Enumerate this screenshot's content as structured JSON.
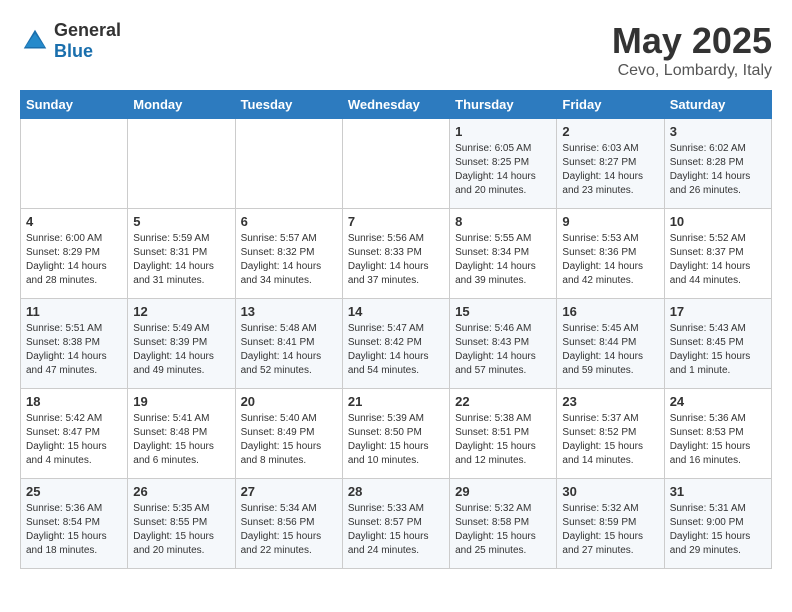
{
  "header": {
    "logo_general": "General",
    "logo_blue": "Blue",
    "month": "May 2025",
    "location": "Cevo, Lombardy, Italy"
  },
  "weekdays": [
    "Sunday",
    "Monday",
    "Tuesday",
    "Wednesday",
    "Thursday",
    "Friday",
    "Saturday"
  ],
  "weeks": [
    [
      {
        "day": "",
        "sunrise": "",
        "sunset": "",
        "daylight": ""
      },
      {
        "day": "",
        "sunrise": "",
        "sunset": "",
        "daylight": ""
      },
      {
        "day": "",
        "sunrise": "",
        "sunset": "",
        "daylight": ""
      },
      {
        "day": "",
        "sunrise": "",
        "sunset": "",
        "daylight": ""
      },
      {
        "day": "1",
        "sunrise": "Sunrise: 6:05 AM",
        "sunset": "Sunset: 8:25 PM",
        "daylight": "Daylight: 14 hours and 20 minutes."
      },
      {
        "day": "2",
        "sunrise": "Sunrise: 6:03 AM",
        "sunset": "Sunset: 8:27 PM",
        "daylight": "Daylight: 14 hours and 23 minutes."
      },
      {
        "day": "3",
        "sunrise": "Sunrise: 6:02 AM",
        "sunset": "Sunset: 8:28 PM",
        "daylight": "Daylight: 14 hours and 26 minutes."
      }
    ],
    [
      {
        "day": "4",
        "sunrise": "Sunrise: 6:00 AM",
        "sunset": "Sunset: 8:29 PM",
        "daylight": "Daylight: 14 hours and 28 minutes."
      },
      {
        "day": "5",
        "sunrise": "Sunrise: 5:59 AM",
        "sunset": "Sunset: 8:31 PM",
        "daylight": "Daylight: 14 hours and 31 minutes."
      },
      {
        "day": "6",
        "sunrise": "Sunrise: 5:57 AM",
        "sunset": "Sunset: 8:32 PM",
        "daylight": "Daylight: 14 hours and 34 minutes."
      },
      {
        "day": "7",
        "sunrise": "Sunrise: 5:56 AM",
        "sunset": "Sunset: 8:33 PM",
        "daylight": "Daylight: 14 hours and 37 minutes."
      },
      {
        "day": "8",
        "sunrise": "Sunrise: 5:55 AM",
        "sunset": "Sunset: 8:34 PM",
        "daylight": "Daylight: 14 hours and 39 minutes."
      },
      {
        "day": "9",
        "sunrise": "Sunrise: 5:53 AM",
        "sunset": "Sunset: 8:36 PM",
        "daylight": "Daylight: 14 hours and 42 minutes."
      },
      {
        "day": "10",
        "sunrise": "Sunrise: 5:52 AM",
        "sunset": "Sunset: 8:37 PM",
        "daylight": "Daylight: 14 hours and 44 minutes."
      }
    ],
    [
      {
        "day": "11",
        "sunrise": "Sunrise: 5:51 AM",
        "sunset": "Sunset: 8:38 PM",
        "daylight": "Daylight: 14 hours and 47 minutes."
      },
      {
        "day": "12",
        "sunrise": "Sunrise: 5:49 AM",
        "sunset": "Sunset: 8:39 PM",
        "daylight": "Daylight: 14 hours and 49 minutes."
      },
      {
        "day": "13",
        "sunrise": "Sunrise: 5:48 AM",
        "sunset": "Sunset: 8:41 PM",
        "daylight": "Daylight: 14 hours and 52 minutes."
      },
      {
        "day": "14",
        "sunrise": "Sunrise: 5:47 AM",
        "sunset": "Sunset: 8:42 PM",
        "daylight": "Daylight: 14 hours and 54 minutes."
      },
      {
        "day": "15",
        "sunrise": "Sunrise: 5:46 AM",
        "sunset": "Sunset: 8:43 PM",
        "daylight": "Daylight: 14 hours and 57 minutes."
      },
      {
        "day": "16",
        "sunrise": "Sunrise: 5:45 AM",
        "sunset": "Sunset: 8:44 PM",
        "daylight": "Daylight: 14 hours and 59 minutes."
      },
      {
        "day": "17",
        "sunrise": "Sunrise: 5:43 AM",
        "sunset": "Sunset: 8:45 PM",
        "daylight": "Daylight: 15 hours and 1 minute."
      }
    ],
    [
      {
        "day": "18",
        "sunrise": "Sunrise: 5:42 AM",
        "sunset": "Sunset: 8:47 PM",
        "daylight": "Daylight: 15 hours and 4 minutes."
      },
      {
        "day": "19",
        "sunrise": "Sunrise: 5:41 AM",
        "sunset": "Sunset: 8:48 PM",
        "daylight": "Daylight: 15 hours and 6 minutes."
      },
      {
        "day": "20",
        "sunrise": "Sunrise: 5:40 AM",
        "sunset": "Sunset: 8:49 PM",
        "daylight": "Daylight: 15 hours and 8 minutes."
      },
      {
        "day": "21",
        "sunrise": "Sunrise: 5:39 AM",
        "sunset": "Sunset: 8:50 PM",
        "daylight": "Daylight: 15 hours and 10 minutes."
      },
      {
        "day": "22",
        "sunrise": "Sunrise: 5:38 AM",
        "sunset": "Sunset: 8:51 PM",
        "daylight": "Daylight: 15 hours and 12 minutes."
      },
      {
        "day": "23",
        "sunrise": "Sunrise: 5:37 AM",
        "sunset": "Sunset: 8:52 PM",
        "daylight": "Daylight: 15 hours and 14 minutes."
      },
      {
        "day": "24",
        "sunrise": "Sunrise: 5:36 AM",
        "sunset": "Sunset: 8:53 PM",
        "daylight": "Daylight: 15 hours and 16 minutes."
      }
    ],
    [
      {
        "day": "25",
        "sunrise": "Sunrise: 5:36 AM",
        "sunset": "Sunset: 8:54 PM",
        "daylight": "Daylight: 15 hours and 18 minutes."
      },
      {
        "day": "26",
        "sunrise": "Sunrise: 5:35 AM",
        "sunset": "Sunset: 8:55 PM",
        "daylight": "Daylight: 15 hours and 20 minutes."
      },
      {
        "day": "27",
        "sunrise": "Sunrise: 5:34 AM",
        "sunset": "Sunset: 8:56 PM",
        "daylight": "Daylight: 15 hours and 22 minutes."
      },
      {
        "day": "28",
        "sunrise": "Sunrise: 5:33 AM",
        "sunset": "Sunset: 8:57 PM",
        "daylight": "Daylight: 15 hours and 24 minutes."
      },
      {
        "day": "29",
        "sunrise": "Sunrise: 5:32 AM",
        "sunset": "Sunset: 8:58 PM",
        "daylight": "Daylight: 15 hours and 25 minutes."
      },
      {
        "day": "30",
        "sunrise": "Sunrise: 5:32 AM",
        "sunset": "Sunset: 8:59 PM",
        "daylight": "Daylight: 15 hours and 27 minutes."
      },
      {
        "day": "31",
        "sunrise": "Sunrise: 5:31 AM",
        "sunset": "Sunset: 9:00 PM",
        "daylight": "Daylight: 15 hours and 29 minutes."
      }
    ]
  ]
}
